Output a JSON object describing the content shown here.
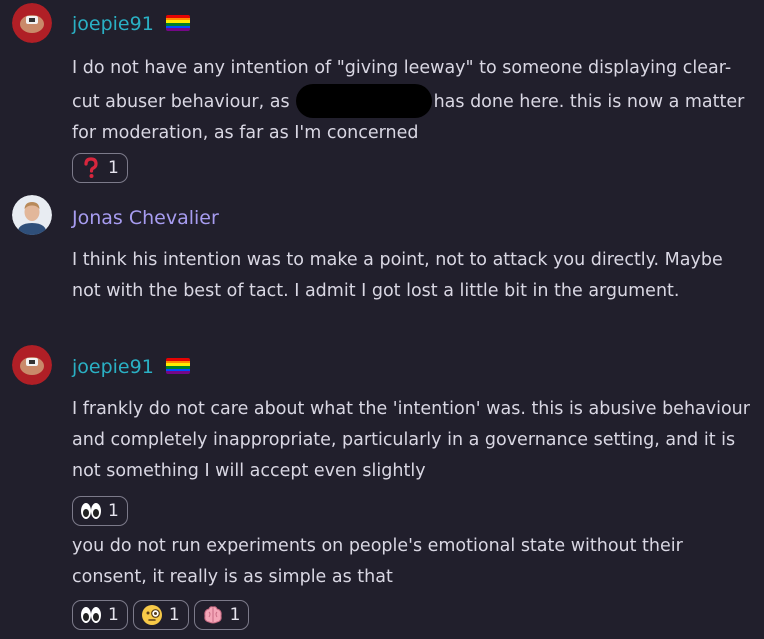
{
  "messages": [
    {
      "username": "joepie91",
      "name_color": "#2ab0c4",
      "avatar_icon": "red-circle-avatar-icon",
      "badge_icon": "rainbow-flag-icon",
      "text_before_redaction": "I do not have any intention of \"giving leeway\" to someone displaying clear-cut abuser behaviour, as",
      "text_after_redaction": "has done here. this is now a matter for moderation, as far as I'm concerned",
      "reactions": [
        {
          "emoji_icon": "red-question-mark-icon",
          "count": "1"
        }
      ]
    },
    {
      "username": "Jonas Chevalier",
      "name_color": "#a79cf0",
      "avatar_icon": "profile-photo-avatar-icon",
      "text": "I think his intention was to make a point, not to attack you directly. Maybe not with the best of tact. I admit I got lost a little bit in the argument."
    },
    {
      "username": "joepie91",
      "name_color": "#2ab0c4",
      "avatar_icon": "red-circle-avatar-icon",
      "badge_icon": "rainbow-flag-icon",
      "text": "I frankly do not care about what the 'intention' was. this is abusive behaviour and completely inappropriate, particularly in a governance setting, and it is not something I will accept even slightly",
      "reactions": [
        {
          "emoji_icon": "eyes-icon",
          "count": "1"
        }
      ],
      "followup_text": "you do not run experiments on people's emotional state without their consent, it really is as simple as that",
      "followup_reactions": [
        {
          "emoji_icon": "eyes-icon",
          "count": "1"
        },
        {
          "emoji_icon": "monocle-face-icon",
          "count": "1"
        },
        {
          "emoji_icon": "brain-icon",
          "count": "1"
        }
      ]
    }
  ],
  "colors": {
    "background": "#211f2c",
    "text": "#d9d7e3",
    "reaction_border": "#7c7a8a"
  }
}
